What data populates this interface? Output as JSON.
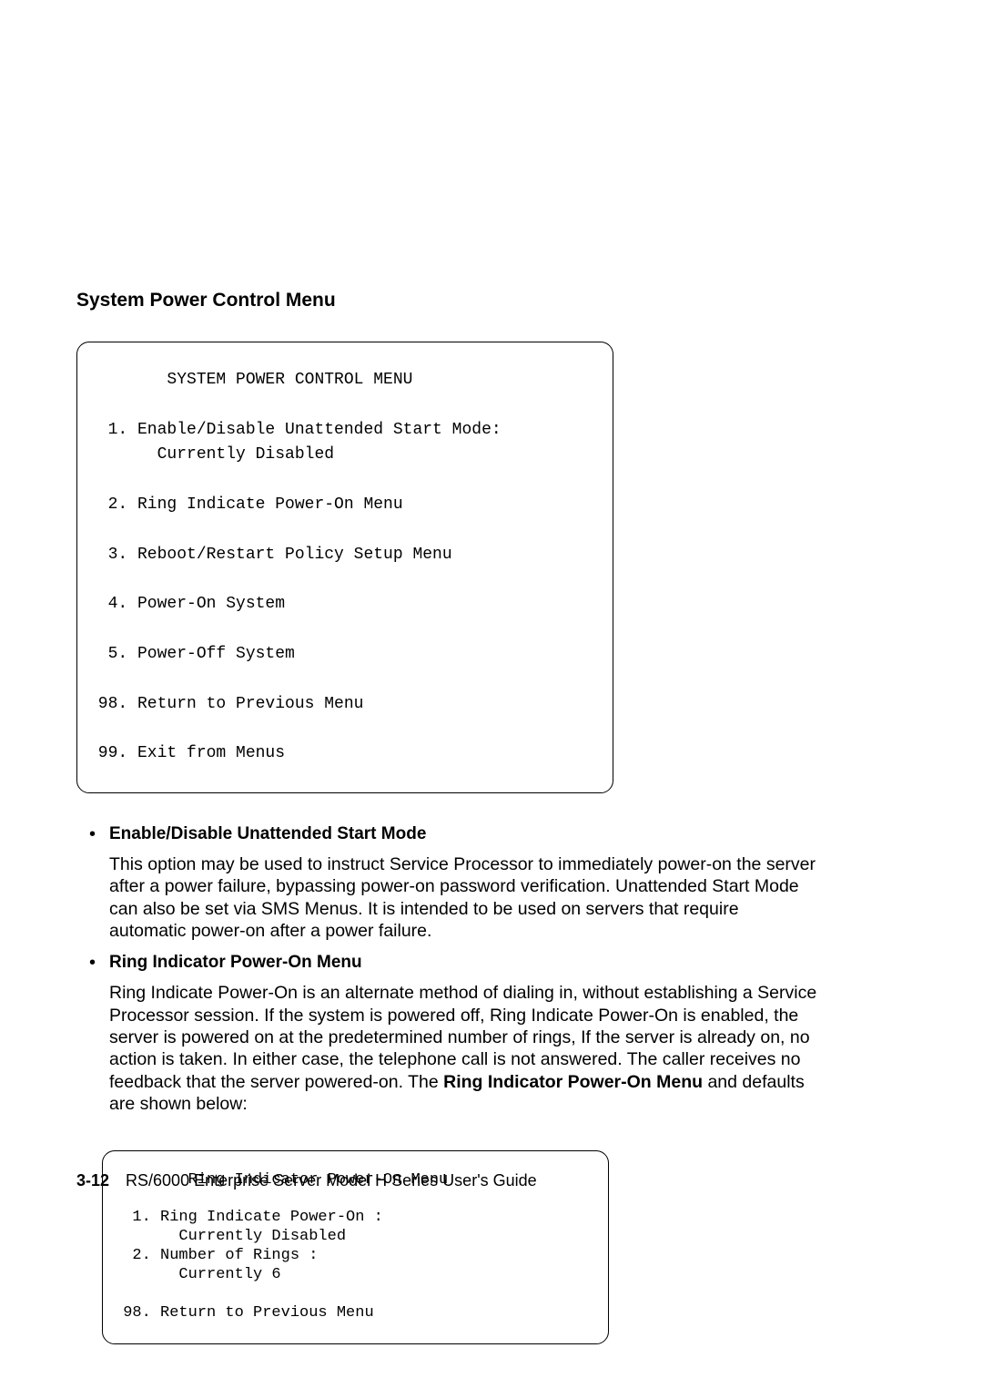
{
  "heading": "System Power Control Menu",
  "terminal1": "        SYSTEM POWER CONTROL MENU\n\n  1. Enable/Disable Unattended Start Mode:\n       Currently Disabled\n\n  2. Ring Indicate Power-On Menu\n\n  3. Reboot/Restart Policy Setup Menu\n\n  4. Power-On System\n\n  5. Power-Off System\n\n 98. Return to Previous Menu\n\n 99. Exit from Menus",
  "bullet1": {
    "title": "Enable/Disable Unattended Start Mode",
    "text": "This option may be used to instruct Service Processor to immediately power-on the server after a power failure, bypassing power-on password verification.  Unattended Start Mode can also be set via SMS Menus.  It is intended to be used on servers that require automatic power-on after a power failure."
  },
  "bullet2": {
    "title": "Ring Indicator Power-On Menu",
    "text_before": "Ring Indicate Power-On is an alternate method of dialing in, without establishing a Service Processor session.  If the system is powered off, Ring Indicate Power-On is enabled, the server is powered on at the predetermined number of rings, If the server is already on, no action is taken. In either case, the telephone call is not answered. The caller receives no feedback that the server powered-on.  The ",
    "bold": "Ring Indicator Power-On Menu",
    "text_after": " and defaults are shown below:"
  },
  "terminal2": "        Ring Indicator Power-On Menu\n\n  1. Ring Indicate Power-On :\n       Currently Disabled\n  2. Number of Rings :\n       Currently 6\n\n 98. Return to Previous Menu",
  "footer": {
    "page": "3-12",
    "title": "RS/6000 Enterprise Server Model H Series User's Guide"
  }
}
